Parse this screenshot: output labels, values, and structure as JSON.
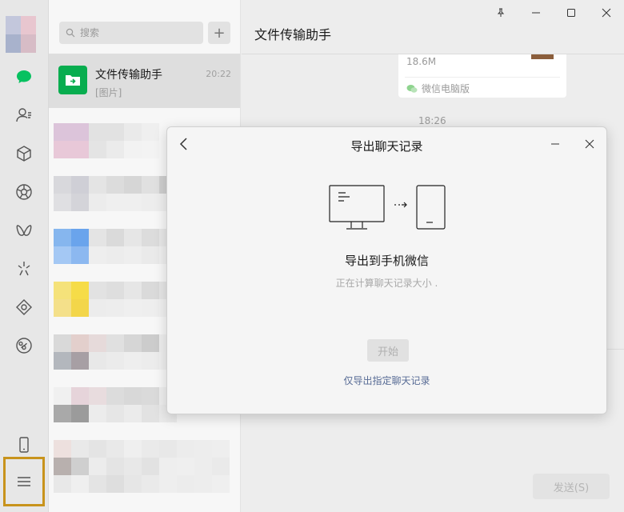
{
  "search": {
    "placeholder": "搜索",
    "add_label": "+"
  },
  "chats": [
    {
      "name": "文件传输助手",
      "time": "20:22",
      "preview": "[图片]"
    }
  ],
  "chat_window": {
    "title": "文件传输助手",
    "file_size": "18.6M",
    "file_source": "微信电脑版",
    "timestamp": "18:26",
    "send_label": "发送(S)"
  },
  "dialog": {
    "title": "导出聊天记录",
    "heading": "导出到手机微信",
    "status": "正在计算聊天记录大小 .",
    "start_label": "开始",
    "link_label": "仅导出指定聊天记录"
  },
  "colors": {
    "brand_green": "#08ad4f",
    "link_blue": "#576b95",
    "highlight": "#c8931c"
  },
  "icons": {
    "nav": [
      "chat-icon",
      "contacts-icon",
      "favorites-icon",
      "moments-icon",
      "channels-icon",
      "search-sparkle-icon",
      "mini-programs-icon",
      "settings-disc-icon",
      "phone-icon",
      "menu-icon"
    ],
    "window": [
      "pin-icon",
      "minimize-icon",
      "maximize-icon",
      "close-icon"
    ]
  }
}
